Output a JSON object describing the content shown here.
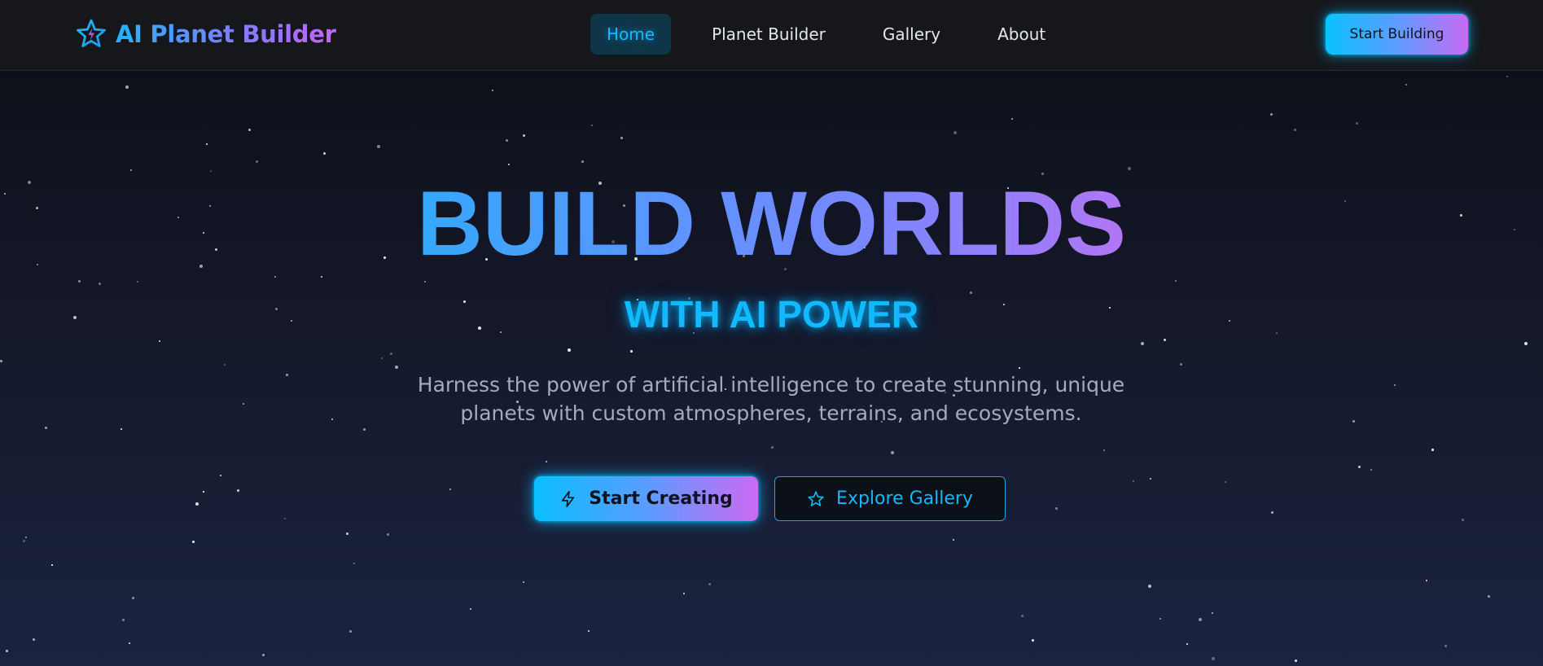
{
  "app": {
    "name": "AI Planet Builder",
    "logo_icon": "star-icon"
  },
  "nav": {
    "items": [
      {
        "label": "Home",
        "active": true
      },
      {
        "label": "Planet Builder",
        "active": false
      },
      {
        "label": "Gallery",
        "active": false
      },
      {
        "label": "About",
        "active": false
      }
    ],
    "cta_label": "Start Building"
  },
  "hero": {
    "title": "BUILD WORLDS",
    "subtitle": "WITH AI POWER",
    "description_line1": "Harness the power of artificial intelligence to create stunning, unique",
    "description_line2": "planets with custom atmospheres, terrains, and ecosystems.",
    "primary_button": {
      "label": "Start Creating",
      "icon": "lightning-icon"
    },
    "secondary_button": {
      "label": "Explore Gallery",
      "icon": "star-icon"
    }
  },
  "colors": {
    "accent_cyan": "#0ab8ff",
    "accent_purple": "#c86bf3",
    "background_top": "#0c0d14",
    "background_bottom": "#1b2340",
    "navbar": "#16171b"
  }
}
